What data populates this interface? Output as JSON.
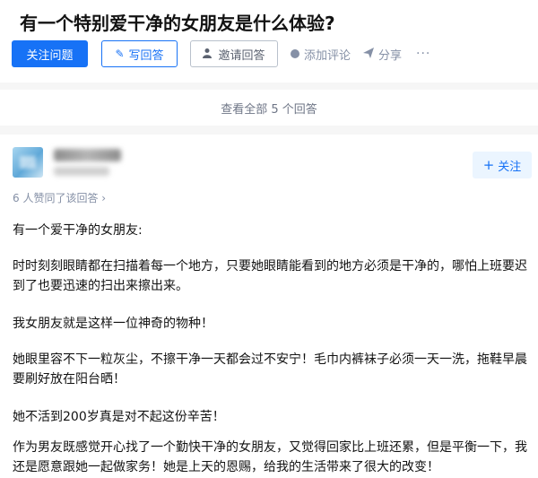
{
  "question": {
    "title": "有一个特别爱干净的女朋友是什么体验?",
    "follow_label": "关注问题",
    "write_label": "写回答",
    "invite_label": "邀请回答",
    "comment_label": "添加评论",
    "share_label": "分享",
    "more_label": "···"
  },
  "answers_summary": {
    "view_all": "查看全部 5 个回答"
  },
  "answer": {
    "follow_label": "关注",
    "upvote_text": "6 人赞同了该回答 ›",
    "paragraphs": [
      "有一个爱干净的女朋友:",
      "时时刻刻眼睛都在扫描着每一个地方，只要她眼睛能看到的地方必须是干净的，哪怕上班要迟到了也要迅速的扫出来擦出来。",
      "我女朋友就是这样一位神奇的物种！",
      "她眼里容不下一粒灰尘，不擦干净一天都会过不安宁！毛巾内裤袜子必须一天一洗，拖鞋早晨要刷好放在阳台晒！",
      "她不活到200岁真是对不起这份辛苦！",
      "作为男友既感觉开心找了一个勤快干净的女朋友，又觉得回家比上班还累，但是平衡一下，我还是愿意跟她一起做家务！她是上天的恩赐，给我的生活带来了很大的改变！"
    ]
  },
  "icons": {
    "pencil": "pencil-icon",
    "invite": "person-add-icon",
    "comment": "comment-icon",
    "share": "share-icon",
    "plus": "plus-icon"
  },
  "colors": {
    "accent": "#1772f6",
    "muted": "#8590a6"
  }
}
